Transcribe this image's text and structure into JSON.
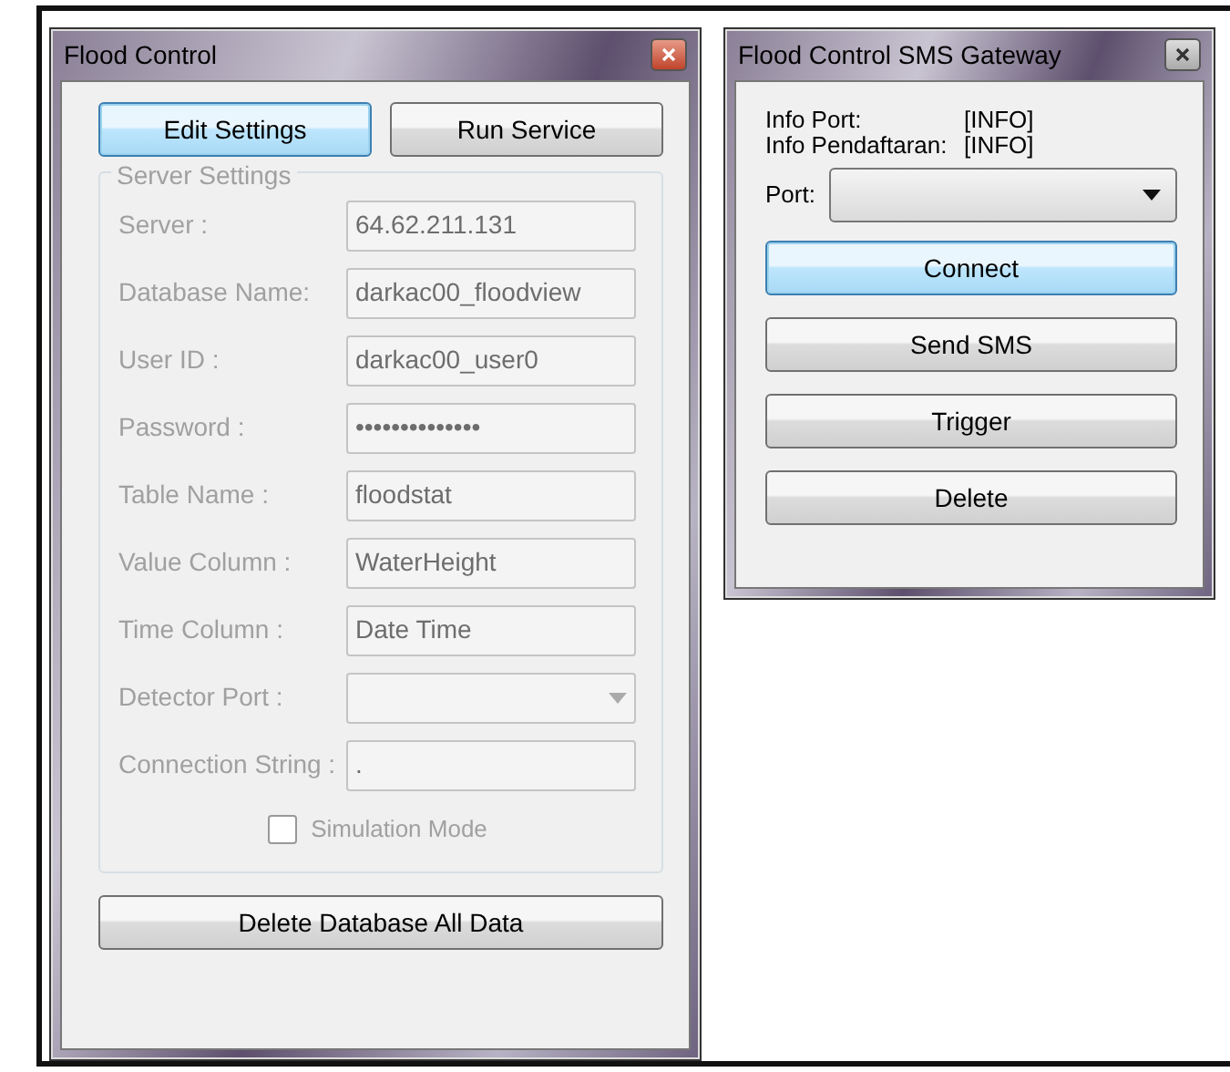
{
  "main_window": {
    "title": "Flood Control",
    "close_active": true,
    "top_buttons": [
      {
        "label": "Edit Settings",
        "focused": true
      },
      {
        "label": "Run Service",
        "focused": false
      }
    ],
    "group": {
      "title": "Server Settings",
      "disabled": true,
      "fields": [
        {
          "label": "Server :",
          "kind": "text",
          "value": "64.62.211.131"
        },
        {
          "label": "Database Name:",
          "kind": "text",
          "value": "darkac00_floodview"
        },
        {
          "label": "User ID :",
          "kind": "text",
          "value": "darkac00_user0"
        },
        {
          "label": "Password :",
          "kind": "text",
          "value": "••••••••••••••"
        },
        {
          "label": "Table Name :",
          "kind": "text",
          "value": "floodstat"
        },
        {
          "label": "Value Column :",
          "kind": "text",
          "value": "WaterHeight"
        },
        {
          "label": "Time Column :",
          "kind": "text",
          "value": "Date Time"
        },
        {
          "label": "Detector Port :",
          "kind": "dropdown"
        },
        {
          "label": "Connection String :",
          "kind": "text",
          "value": "."
        }
      ],
      "checkbox": {
        "label": "Simulation Mode",
        "checked": false
      }
    },
    "bottom_button": {
      "label": "Delete Database All Data",
      "focused": false
    }
  },
  "sms_window": {
    "title": "Flood Control SMS Gateway",
    "close_active": false,
    "info": [
      {
        "label": "Info Port:",
        "value": "[INFO]"
      },
      {
        "label": "Info Pendaftaran:",
        "value": "[INFO]"
      }
    ],
    "port": {
      "label": "Port:"
    },
    "buttons": [
      {
        "label": "Connect",
        "focused": true
      },
      {
        "label": "Send SMS",
        "focused": false
      },
      {
        "label": "Trigger",
        "focused": false
      },
      {
        "label": "Delete",
        "focused": false
      }
    ]
  }
}
